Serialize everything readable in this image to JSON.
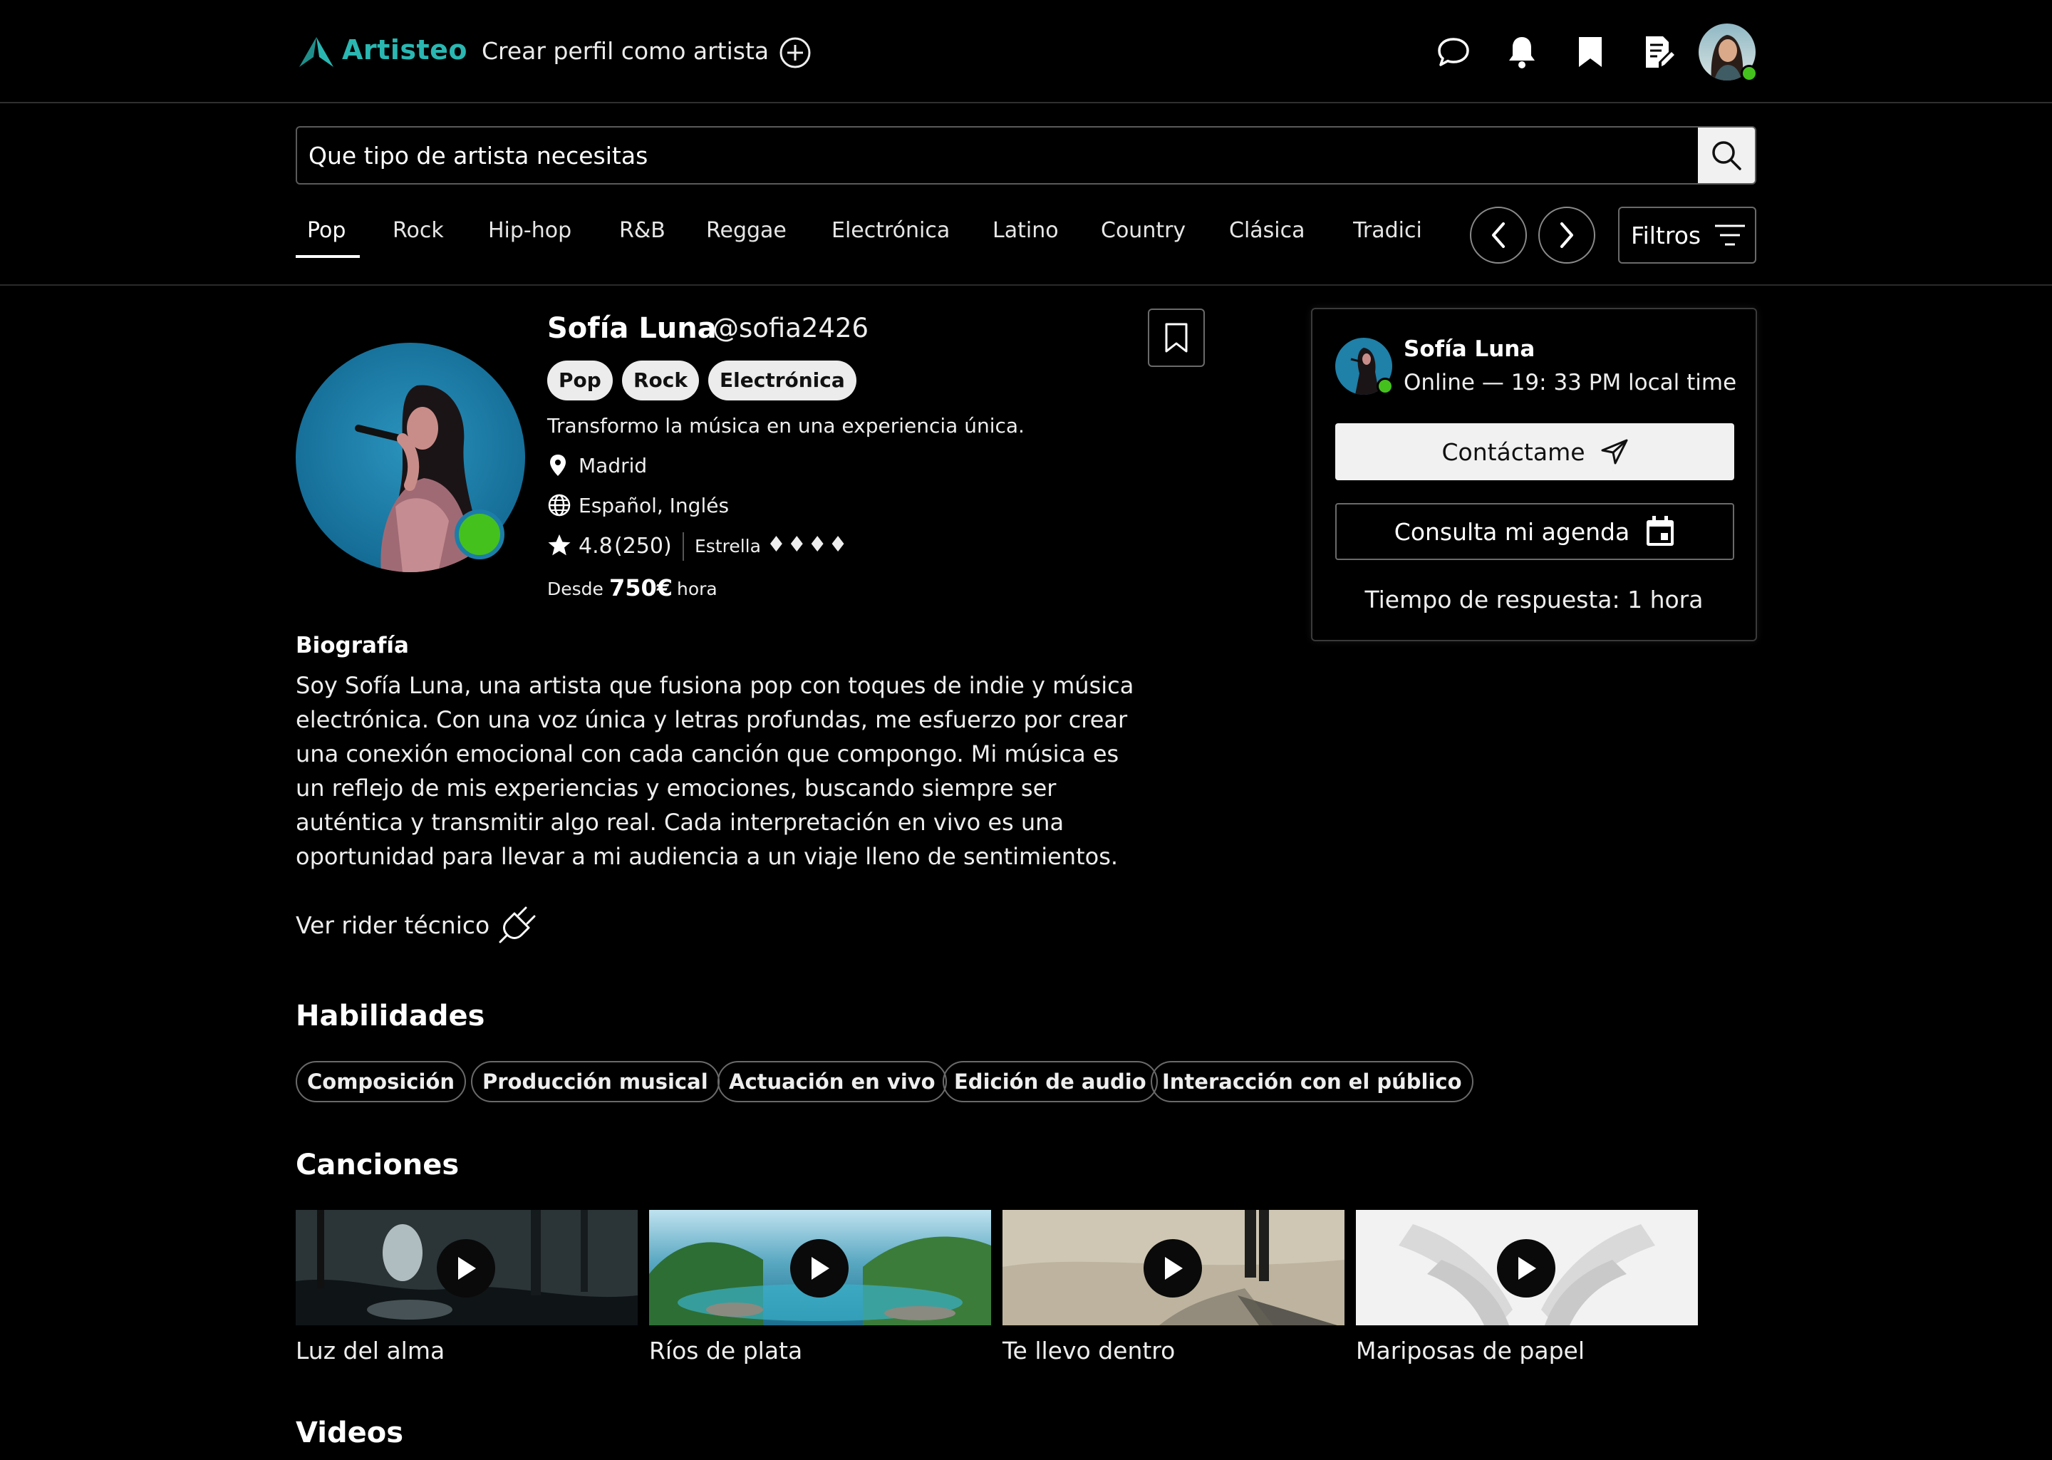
{
  "header": {
    "logo_text": "Artisteo",
    "create_profile_label": "Crear perfil como artista",
    "icons": [
      "chat-icon",
      "bell-icon",
      "bookmark-icon",
      "edit-document-icon"
    ],
    "accent_color": "#2ab7b2"
  },
  "search": {
    "placeholder": "Que tipo de artista necesitas"
  },
  "genres": {
    "items": [
      "Pop",
      "Rock",
      "Hip-hop",
      "R&B",
      "Reggae",
      "Electrónica",
      "Latino",
      "Country",
      "Clásica",
      "Tradici"
    ],
    "active": "Pop",
    "filters_label": "Filtros"
  },
  "profile": {
    "name": "Sofía Luna",
    "handle": "@sofia2426",
    "tags": [
      "Pop",
      "Rock",
      "Electrónica"
    ],
    "tagline": "Transformo la música en una experiencia única.",
    "location": "Madrid",
    "languages": "Español, Inglés",
    "rating": "4.8",
    "reviews": "(250)",
    "level_label": "Estrella",
    "level_diamonds": "♦♦♦♦",
    "price_prefix": "Desde",
    "price": "750€",
    "price_unit": "hora",
    "online_color": "#45c11e"
  },
  "contact_card": {
    "name": "Sofía Luna",
    "status": "Online — 19: 33 PM local time",
    "contact_label": "Contáctame",
    "agenda_label": "Consulta mi agenda",
    "response_time": "Tiempo de respuesta: 1 hora"
  },
  "bio": {
    "heading": "Biografía",
    "lines": [
      "Soy Sofía Luna, una artista que fusiona pop con toques de indie y música",
      "electrónica. Con una voz única y letras profundas, me esfuerzo por crear",
      "una conexión emocional con cada canción que compongo. Mi música es",
      "un reflejo de mis experiencias y emociones, buscando siempre ser",
      "auténtica y transmitir algo real. Cada interpretación en vivo es una",
      "oportunidad para llevar a mi audiencia a un viaje lleno de sentimientos."
    ],
    "rider_label": "Ver rider técnico"
  },
  "skills": {
    "heading": "Habilidades",
    "items": [
      "Composición",
      "Producción musical",
      "Actuación en vivo",
      "Edición de audio",
      "Interacción con el público"
    ]
  },
  "songs": {
    "heading": "Canciones",
    "items": [
      "Luz del alma",
      "Ríos de plata",
      "Te llevo dentro",
      "Mariposas de papel"
    ]
  },
  "videos": {
    "heading": "Videos"
  }
}
